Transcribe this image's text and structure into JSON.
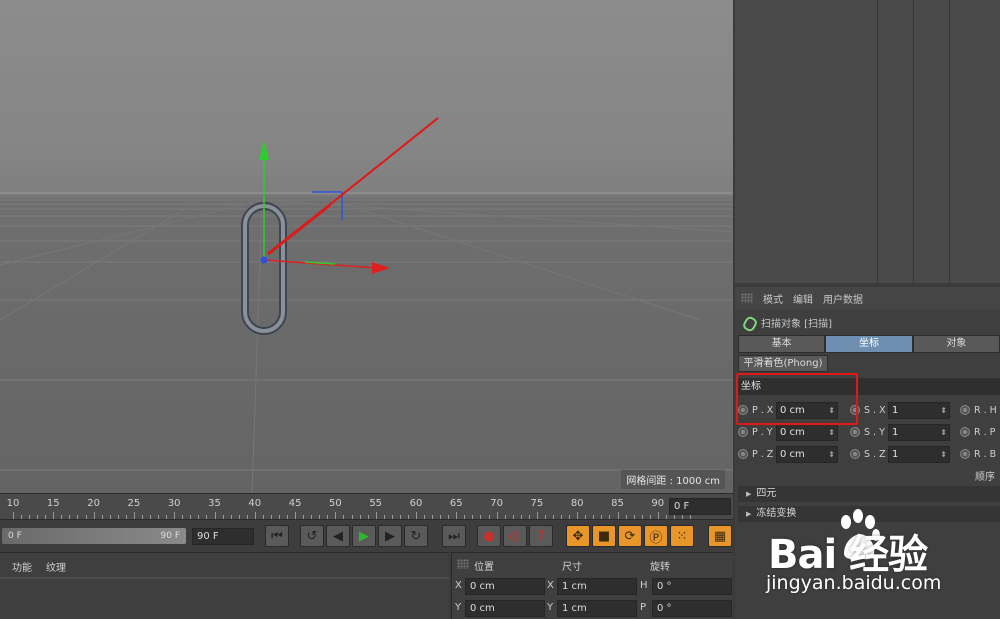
{
  "viewport": {
    "grid_spacing_label": "网格间距 : 1000 cm"
  },
  "attributes": {
    "menu": [
      "模式",
      "编辑",
      "用户数据"
    ],
    "object_title": "扫描对象 [扫描]",
    "tabs": [
      {
        "label": "基本",
        "active": false
      },
      {
        "label": "坐标",
        "active": true
      },
      {
        "label": "对象",
        "active": false
      }
    ],
    "phong_tab": "平滑着色(Phong)",
    "section_title": "坐标",
    "rows": [
      {
        "p_label": "P . X",
        "p_value": "0 cm",
        "s_label": "S . X",
        "s_value": "1",
        "r_label": "R . H"
      },
      {
        "p_label": "P . Y",
        "p_value": "0 cm",
        "s_label": "S . Y",
        "s_value": "1",
        "r_label": "R . P"
      },
      {
        "p_label": "P . Z",
        "p_value": "0 cm",
        "s_label": "S . Z",
        "s_value": "1",
        "r_label": "R . B"
      }
    ],
    "order_label": "顺序",
    "collapsed_sections": [
      "四元",
      "冻结变换"
    ]
  },
  "timeline": {
    "ticks": [
      "10",
      "15",
      "20",
      "25",
      "30",
      "35",
      "40",
      "45",
      "50",
      "55",
      "60",
      "65",
      "70",
      "75",
      "80",
      "85",
      "90"
    ],
    "current_frame": "0 F",
    "range_start": "0 F",
    "range_end": "90 F",
    "end_field": "90 F"
  },
  "materials": {
    "menu": [
      "功能",
      "纹理"
    ]
  },
  "coordinates": {
    "headers": {
      "position": "位置",
      "size": "尺寸",
      "rotation": "旋转"
    },
    "rows": [
      {
        "p_axis": "X",
        "p_value": "0 cm",
        "s_axis": "X",
        "s_value": "1 cm",
        "r_axis": "H",
        "r_value": "0 °"
      },
      {
        "p_axis": "Y",
        "p_value": "0 cm",
        "s_axis": "Y",
        "s_value": "1 cm",
        "r_axis": "P",
        "r_value": "0 °"
      }
    ]
  },
  "watermark": {
    "logo": "Bai  经验",
    "url": "jingyan.baidu.com"
  },
  "colors": {
    "annotation_red": "#e01818",
    "axis_green": "#2ecc2e",
    "axis_red": "#e02020",
    "axis_blue": "#3050e0",
    "active_tab": "#6f8fb0",
    "orange_tool": "#e8952a"
  }
}
